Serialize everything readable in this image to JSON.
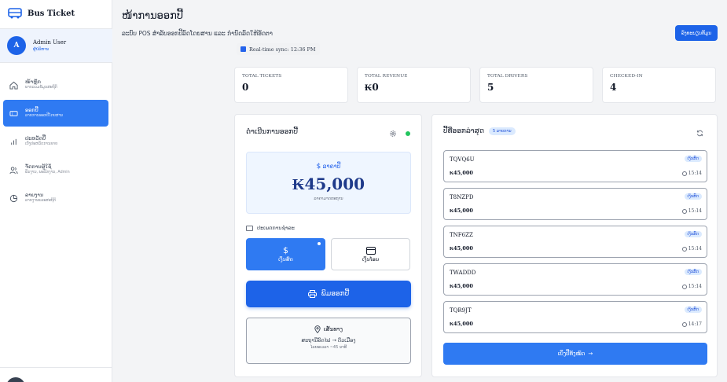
{
  "brand": {
    "name": "Bus Ticket",
    "icon": "bus-icon",
    "color": "#1d63e8"
  },
  "user": {
    "initial": "A",
    "name": "Admin User",
    "role": "ຜູ້ບໍລິຫານ"
  },
  "sidebar": {
    "items": [
      {
        "label": "ໜ້າຫຼັກ",
        "sub": "ພາບລວມຂໍ້ມູນສະຖິຕິ",
        "icon": "home-icon",
        "active": false
      },
      {
        "label": "ອອກປີ້",
        "sub": "ລາຍການອອກປີ້ໂດຍສານ",
        "icon": "ticket-icon",
        "active": true
      },
      {
        "label": "ປະຫວັດປີ້",
        "sub": "ເບິ່ງປະຫວັດການຂາຍ",
        "icon": "bar-chart-icon",
        "active": false
      },
      {
        "label": "ຈັດການຜູ້ໃຊ້",
        "sub": "ພັນງານ, ພະນັກງານ, Admin",
        "icon": "users-icon",
        "active": false
      },
      {
        "label": "ລາຍງານ",
        "sub": "ລາຍງານແລະສະຖິຕິ",
        "icon": "pie-chart-icon",
        "active": false
      }
    ]
  },
  "header": {
    "title": "ໜ້າການອອກປີ້",
    "subtitle": "ລະບົບ POS ສຳລັບອອກປີ້ລົດໂດຍສານ ແລະ ກຳນົດລົດໃຫ້ອັດຕາ",
    "sync": "Real-time sync: 12:36 PM",
    "action_button": "ລົງທະບຽນທັ້ມູນ"
  },
  "stats": [
    {
      "label": "TOTAL TICKETS",
      "value": "0"
    },
    {
      "label": "TOTAL REVENUE",
      "value": "₭0"
    },
    {
      "label": "TOTAL DRIVERS",
      "value": "5"
    },
    {
      "label": "CHECKED-IN",
      "value": "4"
    }
  ],
  "issue_panel": {
    "title": "ດຳເນີນການອອກປີ້",
    "price_label": "ລາຄາປີ້",
    "price": "₭45,000",
    "price_note": "ລາຄາມາດຕະຖານ",
    "payment_heading": "ປະເພດການຊຳລະ",
    "payment_cash": "ເງິນສົດ",
    "payment_transfer": "ເງິນໂອນ",
    "print_button": "ພິມອອກປີ້",
    "route_title": "ເສັ້ນທາງ",
    "route_path": "ສະຖານີລົດໄຟ → ຕົວເມືອງ",
    "route_time": "ໄລຍະເວລາ ~45 ນາທີ"
  },
  "recent_panel": {
    "title": "ປີ້ທີ່ອອກລ່າສຸດ",
    "count_badge": "5 ລາຍການ",
    "view_all": "ເບິ່ງປີ້ທັງໝົດ",
    "tickets": [
      {
        "code": "TQVQ6U",
        "price": "₭45,000",
        "status": "ເງິນສົດ",
        "time": "15:14"
      },
      {
        "code": "T8NZPD",
        "price": "₭45,000",
        "status": "ເງິນສົດ",
        "time": "15:14"
      },
      {
        "code": "TNF6ZZ",
        "price": "₭45,000",
        "status": "ເງິນສົດ",
        "time": "15:14"
      },
      {
        "code": "TWADDD",
        "price": "₭45,000",
        "status": "ເງິນສົດ",
        "time": "15:14"
      },
      {
        "code": "TQR9JT",
        "price": "₭45,000",
        "status": "ເງິນສົດ",
        "time": "14:17"
      }
    ]
  },
  "colors": {
    "accent": "#2f7af2",
    "primary": "#1d63e8",
    "online": "#22c55e"
  }
}
